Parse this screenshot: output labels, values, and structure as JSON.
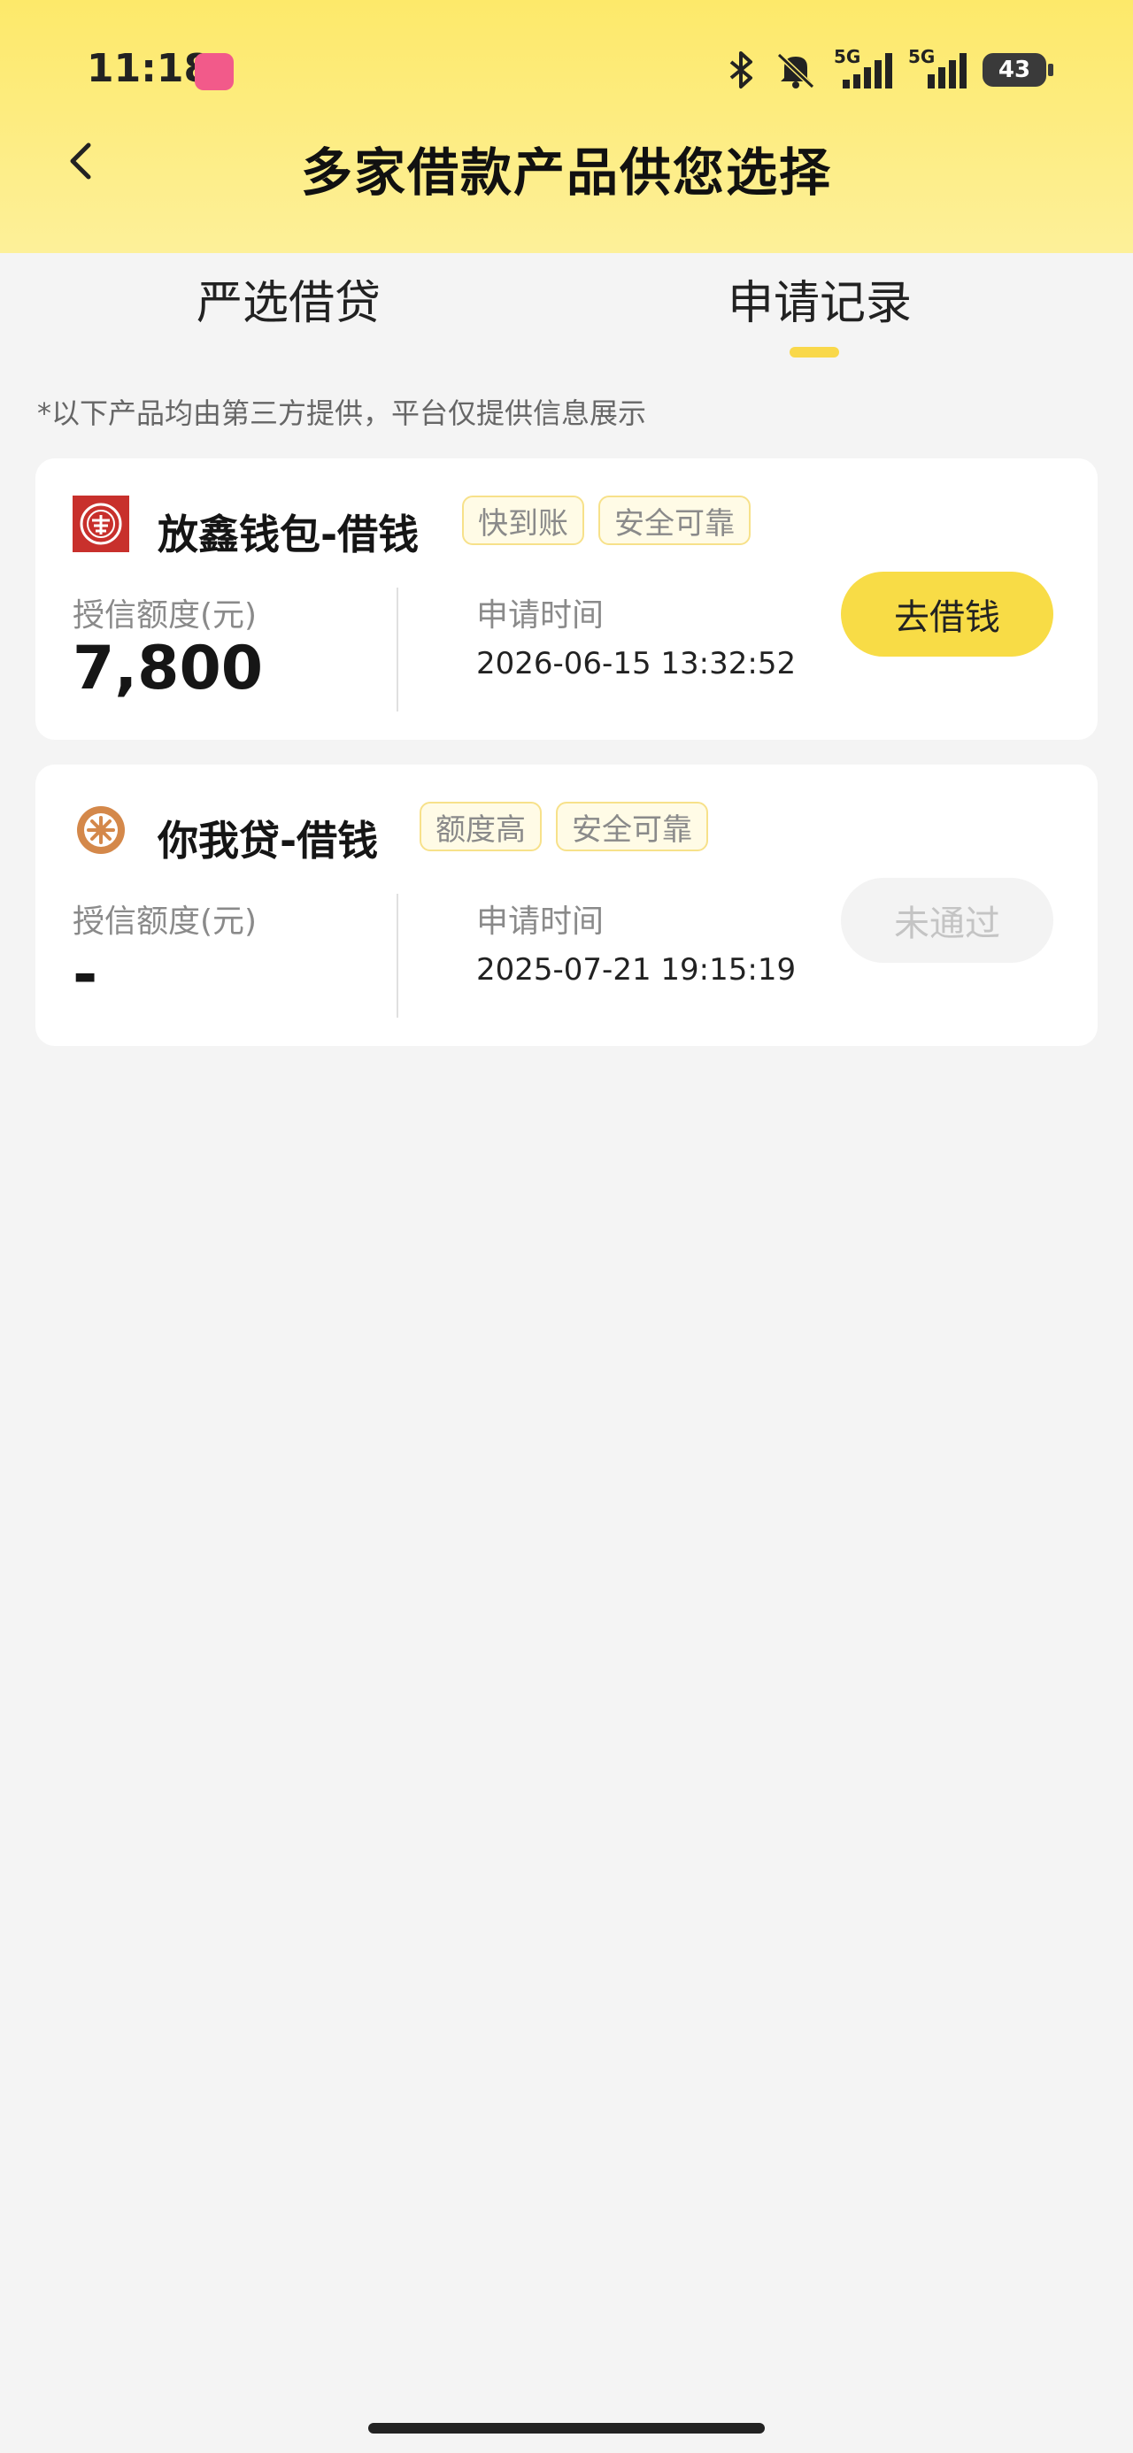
{
  "status_bar": {
    "time": "11:18",
    "battery": "43",
    "network_1": "5G",
    "network_2": "5G"
  },
  "header": {
    "title": "多家借款产品供您选择"
  },
  "tabs": [
    {
      "label": "严选借贷",
      "active": false
    },
    {
      "label": "申请记录",
      "active": true
    }
  ],
  "notice": "*以下产品均由第三方提供，平台仅提供信息展示",
  "records": [
    {
      "name": "放鑫钱包-借钱",
      "tags": [
        "快到账",
        "安全可靠"
      ],
      "amount_label": "授信额度(元)",
      "amount": "7,800",
      "time_label": "申请时间",
      "time": "2026-06-15 13:32:52",
      "action": "去借钱",
      "action_state": "enabled",
      "logo_color": "#c8302c"
    },
    {
      "name": "你我贷-借钱",
      "tags": [
        "额度高",
        "安全可靠"
      ],
      "amount_label": "授信额度(元)",
      "amount": "-",
      "time_label": "申请时间",
      "time": "2025-07-21 19:15:19",
      "action": "未通过",
      "action_state": "disabled",
      "logo_color": "#d4884a"
    }
  ],
  "colors": {
    "accent": "#f8dc46",
    "header_top": "#fde96a",
    "header_bottom": "#fdf099",
    "background": "#f4f4f4"
  }
}
